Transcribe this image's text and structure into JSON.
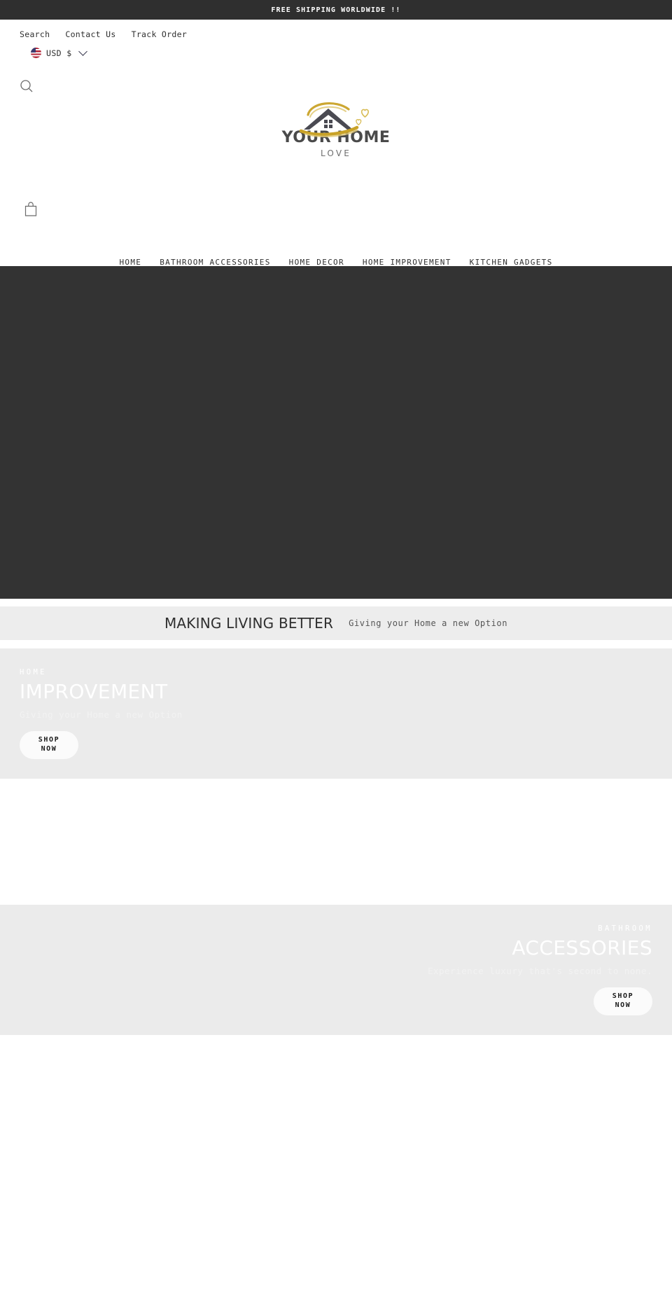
{
  "announcement": {
    "text": "FREE SHIPPING WORLDWIDE !!"
  },
  "utility_nav": {
    "items": [
      {
        "label": "Search"
      },
      {
        "label": "Contact Us"
      },
      {
        "label": "Track Order"
      }
    ]
  },
  "currency": {
    "flag_icon": "us-flag-icon",
    "label": "USD $",
    "chevron_icon": "chevron-down-icon"
  },
  "icons": {
    "search": "search-icon",
    "cart": "shopping-bag-icon"
  },
  "logo": {
    "wordmark": "YOUR HOME",
    "subtext": "LOVE",
    "house_icon": "house-roof-icon",
    "heart_icon": "heart-icon",
    "swoosh_color": "#c9a227",
    "roof_color": "#4a4a52"
  },
  "main_nav": {
    "items": [
      {
        "label": "HOME"
      },
      {
        "label": "BATHROOM ACCESSORIES"
      },
      {
        "label": "HOME DECOR"
      },
      {
        "label": "HOME IMPROVEMENT"
      },
      {
        "label": "KITCHEN GADGETS"
      }
    ]
  },
  "hero": {
    "background_color": "#333333"
  },
  "tagline": {
    "title": "MAKING LIVING BETTER",
    "subtitle": "Giving your Home a new Option"
  },
  "promos": [
    {
      "eyebrow": "HOME",
      "heading": "IMPROVEMENT",
      "description": "Giving your Home a new Option",
      "button_line1": "SHOP",
      "button_line2": "NOW",
      "background_color": "#ebebeb"
    },
    {
      "eyebrow": "BATHROOM",
      "heading": "ACCESSORIES",
      "description": "Experience luxury that's second to none.",
      "button_line1": "SHOP",
      "button_line2": "NOW",
      "background_color": "#ebebeb"
    }
  ]
}
